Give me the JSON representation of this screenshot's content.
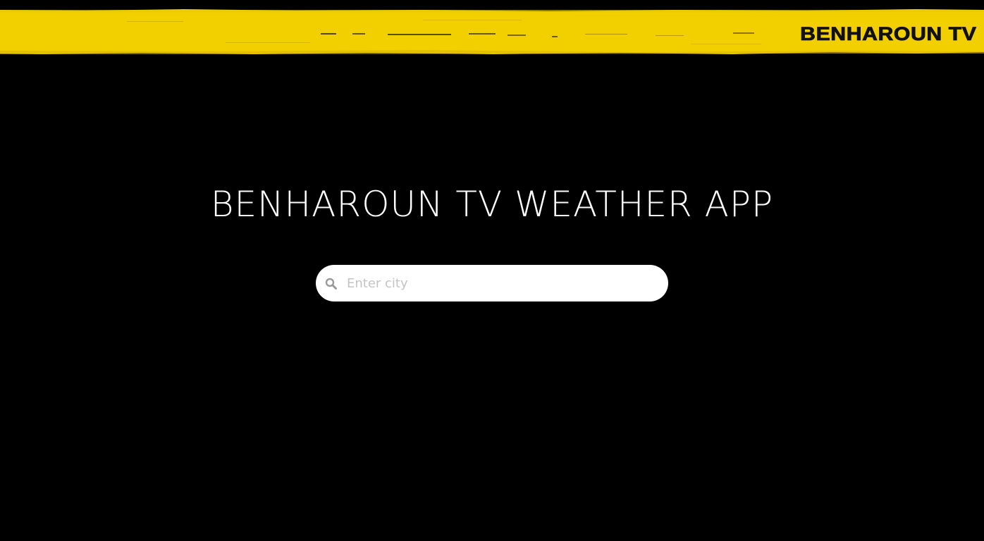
{
  "header": {
    "brand": "BENHAROUN TV",
    "banner_color": "#f2d000"
  },
  "main": {
    "title": "BENHAROUN TV WEATHER APP"
  },
  "search": {
    "placeholder": "Enter city",
    "value": "",
    "icon": "search-icon"
  },
  "colors": {
    "background": "#000000",
    "accent": "#f2d000",
    "text": "#ffffff"
  }
}
